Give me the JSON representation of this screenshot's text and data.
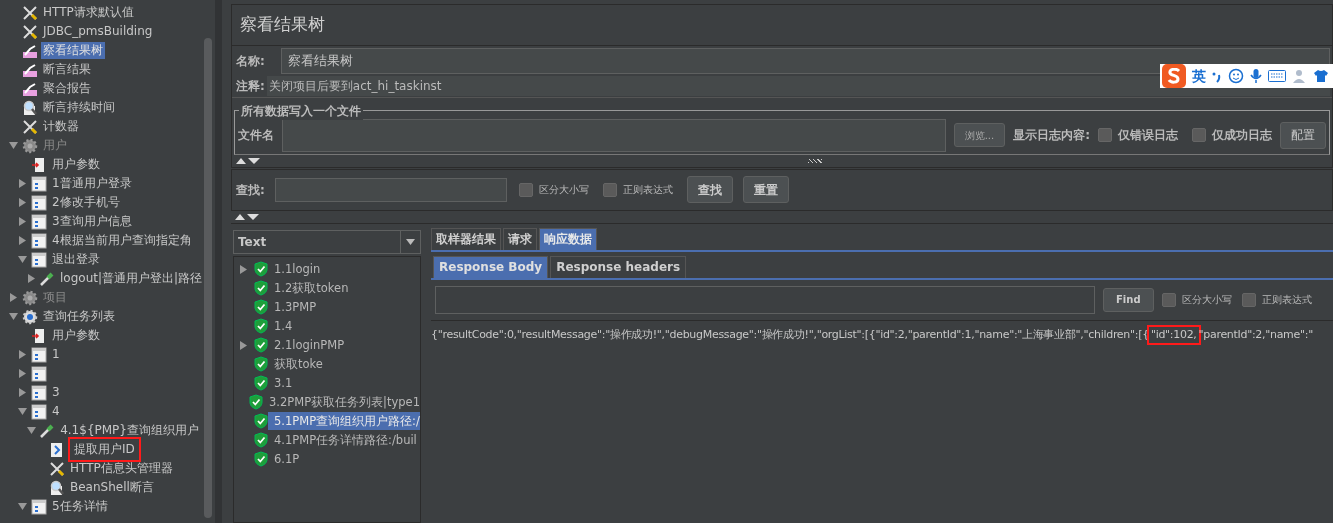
{
  "tree": {
    "items": [
      {
        "label": "HTTP请求默认值",
        "kind": "tool",
        "selected": false,
        "disabled": false,
        "annotated": false
      },
      {
        "label": "JDBC_pmsBuilding",
        "kind": "tool",
        "selected": false,
        "disabled": false,
        "annotated": false
      },
      {
        "label": "察看结果树",
        "kind": "listener",
        "selected": true,
        "disabled": false,
        "annotated": false
      },
      {
        "label": "断言结果",
        "kind": "listener",
        "selected": false,
        "disabled": false,
        "annotated": false
      },
      {
        "label": "聚合报告",
        "kind": "listener",
        "selected": false,
        "disabled": false,
        "annotated": false
      },
      {
        "label": "断言持续时间",
        "kind": "magnifier",
        "selected": false,
        "disabled": false,
        "annotated": false
      },
      {
        "label": "计数器",
        "kind": "tool",
        "selected": false,
        "disabled": false,
        "annotated": false
      },
      {
        "label": "用户",
        "kind": "gear",
        "expanded": true,
        "selected": false,
        "disabled": true,
        "annotated": false,
        "children": [
          {
            "label": "用户参数",
            "kind": "params",
            "selected": false,
            "disabled": false,
            "annotated": false
          },
          {
            "label": "1普通用户登录",
            "kind": "controller",
            "expanded": false,
            "selected": false,
            "disabled": false,
            "annotated": false
          },
          {
            "label": "2修改手机号",
            "kind": "controller",
            "expanded": false,
            "selected": false,
            "disabled": false,
            "annotated": false
          },
          {
            "label": "3查询用户信息",
            "kind": "controller",
            "expanded": false,
            "selected": false,
            "disabled": false,
            "annotated": false
          },
          {
            "label": "4根据当前用户查询指定角",
            "kind": "controller",
            "expanded": false,
            "selected": false,
            "disabled": false,
            "annotated": false
          },
          {
            "label": "退出登录",
            "kind": "controller",
            "expanded": true,
            "selected": false,
            "disabled": false,
            "annotated": false,
            "children": [
              {
                "label": "logout|普通用户登出|路径",
                "kind": "sampler",
                "expanded": false,
                "selected": false,
                "disabled": false,
                "annotated": false
              }
            ]
          }
        ]
      },
      {
        "label": "项目",
        "kind": "gear",
        "expanded": false,
        "selected": false,
        "disabled": true,
        "annotated": false
      },
      {
        "label": "查询任务列表",
        "kind": "gear-active",
        "expanded": true,
        "selected": false,
        "disabled": false,
        "annotated": false,
        "children": [
          {
            "label": "用户参数",
            "kind": "params",
            "selected": false,
            "disabled": false,
            "annotated": false
          },
          {
            "label": "1",
            "kind": "controller",
            "expanded": false,
            "selected": false,
            "disabled": false,
            "annotated": false
          },
          {
            "kind": "controller",
            "expanded": false
          },
          {
            "label": "3",
            "kind": "controller",
            "expanded": false,
            "selected": false,
            "disabled": false,
            "annotated": false
          },
          {
            "label": "4",
            "kind": "controller",
            "expanded": true,
            "selected": false,
            "disabled": false,
            "annotated": false,
            "children": [
              {
                "label": "4.1${PMP}查询组织用户",
                "kind": "sampler",
                "expanded": true,
                "selected": false,
                "disabled": false,
                "annotated": false,
                "children": [
                  {
                    "label": "提取用户ID",
                    "kind": "extractor",
                    "selected": false,
                    "disabled": false,
                    "annotated": true
                  },
                  {
                    "label": "HTTP信息头管理器",
                    "kind": "tool",
                    "selected": false,
                    "disabled": false,
                    "annotated": false
                  },
                  {
                    "label": "BeanShell断言",
                    "kind": "magnifier",
                    "selected": false,
                    "disabled": false,
                    "annotated": false
                  }
                ]
              }
            ]
          },
          {
            "label": "5任务详情",
            "kind": "controller",
            "expanded": true,
            "selected": false,
            "disabled": false,
            "annotated": false
          }
        ]
      }
    ]
  },
  "title": "察看结果树",
  "name": {
    "label": "名称:",
    "value": "察看结果树"
  },
  "comment": {
    "label": "注释:",
    "value": "关闭项目后要到act_hi_taskinst"
  },
  "file_group": {
    "legend": "所有数据写入一个文件",
    "label": "文件名",
    "browse": "浏览...",
    "log_label": "显示日志内容:",
    "checkboxes": [
      {
        "label": "仅错误日志",
        "checked": false
      },
      {
        "label": "仅成功日志",
        "checked": false
      }
    ],
    "config": "配置"
  },
  "ime_toolbar": {
    "mode": "英"
  },
  "search": {
    "label": "查找:",
    "checkboxes": [
      {
        "label": "区分大小写",
        "checked": false
      },
      {
        "label": "正则表达式",
        "checked": false
      }
    ],
    "find": "查找",
    "reset": "重置"
  },
  "renderer": {
    "value": "Text"
  },
  "results": [
    {
      "label": "1.1login",
      "expanded": false,
      "selected": false
    },
    {
      "label": "1.2获取token",
      "selected": false
    },
    {
      "label": "1.3PMP",
      "selected": false
    },
    {
      "label": "1.4",
      "selected": false
    },
    {
      "label": "2.1loginPMP",
      "expanded": false,
      "selected": false
    },
    {
      "label": "获取toke",
      "selected": false
    },
    {
      "label": "3.1",
      "selected": false
    },
    {
      "label": "3.2PMP获取任务列表|type1",
      "selected": false
    },
    {
      "label": "5.1PMP查询组织用户路径:/",
      "selected": true
    },
    {
      "label": "4.1PMP任务详情路径:/buil",
      "selected": false
    },
    {
      "label": "6.1P",
      "selected": false
    }
  ],
  "tabs": [
    {
      "label": "取样器结果",
      "selected": false
    },
    {
      "label": "请求",
      "selected": false
    },
    {
      "label": "响应数据",
      "selected": true
    }
  ],
  "subtabs": [
    {
      "label": "Response Body",
      "selected": true
    },
    {
      "label": "Response headers",
      "selected": false
    }
  ],
  "response_search": {
    "find": "Find",
    "checkboxes": [
      {
        "label": "区分大小写",
        "checked": false
      },
      {
        "label": "正则表达式",
        "checked": false
      }
    ]
  },
  "response_body": {
    "before": "{\"resultCode\":0,\"resultMessage\":\"操作成功!\",\"debugMessage\":\"操作成功!\",\"orgList\":[{\"id\":2,\"parentId\":1,\"name\":\"上海事业部\",\"children\":[{",
    "highlighted": "\"id\":102,",
    "after": "\"parentId\":2,\"name\":\""
  }
}
